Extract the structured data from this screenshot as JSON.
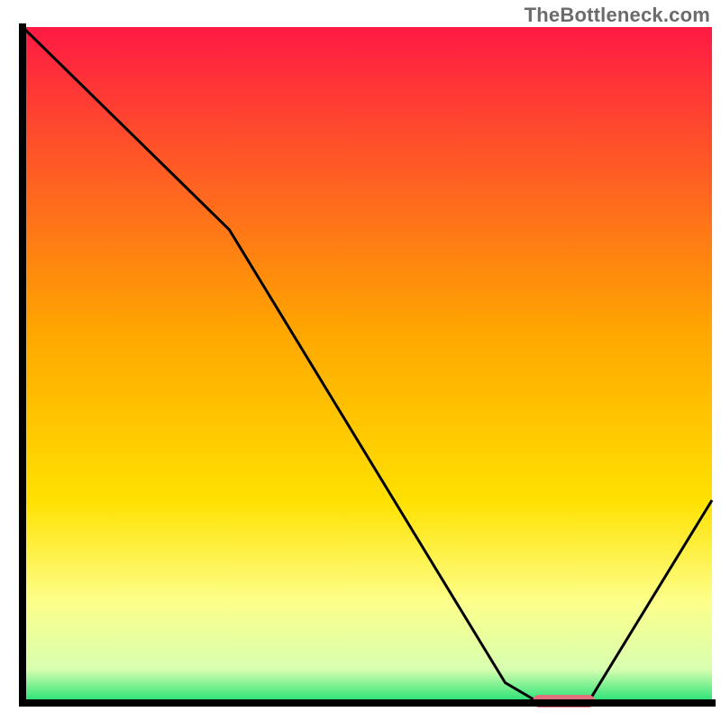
{
  "watermark": "TheBottleneck.com",
  "chart_data": {
    "type": "line",
    "title": "",
    "xlabel": "",
    "ylabel": "",
    "xlim": [
      0,
      100
    ],
    "ylim": [
      0,
      100
    ],
    "curve": [
      {
        "x": 0,
        "y": 100
      },
      {
        "x": 20,
        "y": 80
      },
      {
        "x": 30,
        "y": 70
      },
      {
        "x": 70,
        "y": 3
      },
      {
        "x": 75,
        "y": 0
      },
      {
        "x": 82,
        "y": 0
      },
      {
        "x": 100,
        "y": 30
      }
    ],
    "marker": {
      "x0": 74,
      "x1": 83,
      "y": 0
    },
    "gradient_stops": [
      {
        "offset": 0.0,
        "color": "#ff1a44"
      },
      {
        "offset": 0.45,
        "color": "#ffa600"
      },
      {
        "offset": 0.7,
        "color": "#ffe100"
      },
      {
        "offset": 0.85,
        "color": "#fdff8a"
      },
      {
        "offset": 0.95,
        "color": "#d8ffb0"
      },
      {
        "offset": 1.0,
        "color": "#1ee072"
      }
    ]
  },
  "axis_color": "#000000",
  "curve_color": "#000000",
  "marker_color": "#e0707c"
}
